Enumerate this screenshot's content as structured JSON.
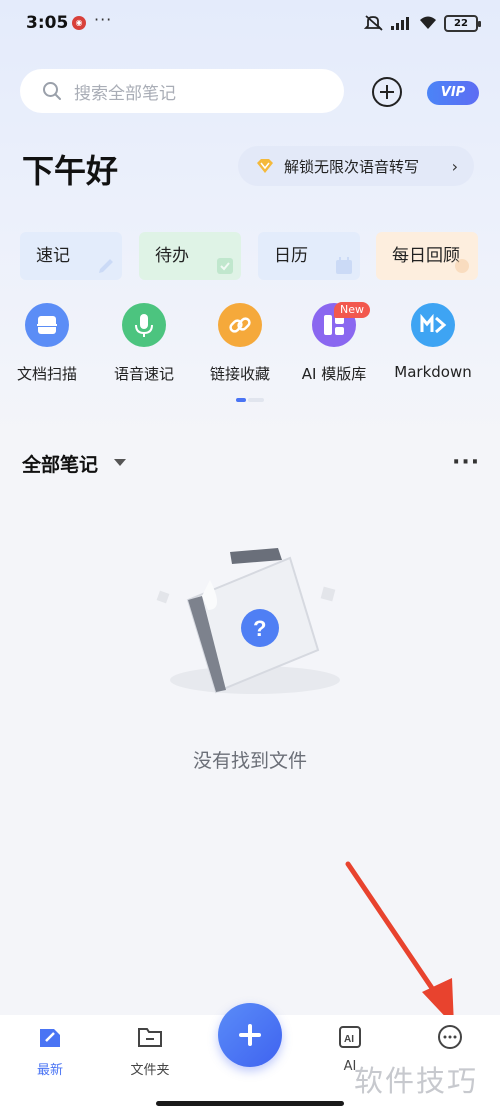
{
  "status_bar": {
    "time": "3:05",
    "more": "···",
    "battery": "22"
  },
  "search": {
    "placeholder": "搜索全部笔记"
  },
  "header": {
    "vip_label": "VIP"
  },
  "greeting": "下午好",
  "promo": {
    "text": "解锁无限次语音转写",
    "arrow": "›"
  },
  "quick_cards": [
    {
      "label": "速记",
      "color": "#e3ecfb"
    },
    {
      "label": "待办",
      "color": "#dff3e6"
    },
    {
      "label": "日历",
      "color": "#e3ecfb"
    },
    {
      "label": "每日回顾",
      "color": "#fdeede"
    }
  ],
  "features": [
    {
      "label": "文档扫描",
      "icon": "scan-icon",
      "color": "#5b8df6"
    },
    {
      "label": "语音速记",
      "icon": "microphone-icon",
      "color": "#4cc47f"
    },
    {
      "label": "链接收藏",
      "icon": "link-icon",
      "color": "#f5a93b"
    },
    {
      "label": "AI 模版库",
      "icon": "template-icon",
      "color": "#8a67f0"
    },
    {
      "label": "Markdown",
      "icon": "markdown-icon",
      "color": "#3ea4f3"
    }
  ],
  "new_badge": "New",
  "list": {
    "title": "全部笔记",
    "more": "···"
  },
  "empty_state": {
    "text": "没有找到文件"
  },
  "bottom_nav": [
    {
      "label": "最新",
      "icon": "latest-icon"
    },
    {
      "label": "文件夹",
      "icon": "folder-icon"
    },
    {
      "label": "AI",
      "icon": "ai-icon"
    },
    {
      "label": "",
      "icon": "more-icon"
    }
  ],
  "watermark": "软件技巧",
  "colors": {
    "accent": "#4a74f4",
    "annotation_arrow": "#e8432e"
  }
}
